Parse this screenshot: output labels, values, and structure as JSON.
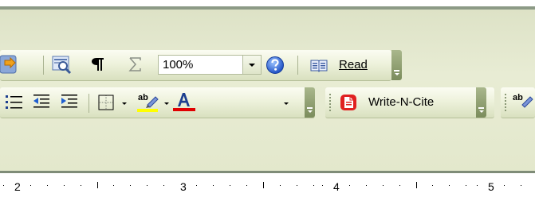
{
  "standard_toolbar": {
    "zoom": {
      "value": "100%"
    },
    "read_button": {
      "label": "Read",
      "mnemonic": "R"
    }
  },
  "formatting_toolbar": {
    "highlight_color": "#ffff00",
    "font_color": "#e00000"
  },
  "writencite_toolbar": {
    "button_label": "Write-N-Cite"
  },
  "ruler": {
    "numbers": [
      "2",
      "3",
      "4",
      "5"
    ]
  },
  "colors": {
    "toolbar_band": "#e3e8cc",
    "toolbar_gradient_top": "#fbfcf2",
    "toolbar_gradient_bottom": "#d9e0bf",
    "grip_end": "#7b8c5c",
    "writencite_icon": "#e02020"
  },
  "icons": [
    "document-map-icon",
    "research-icon",
    "pilcrow-icon",
    "sigma-icon",
    "help-icon",
    "read-icon",
    "bullets-icon",
    "decrease-indent-icon",
    "increase-indent-icon",
    "borders-icon",
    "highlight-icon",
    "font-color-icon",
    "writencite-icon"
  ]
}
